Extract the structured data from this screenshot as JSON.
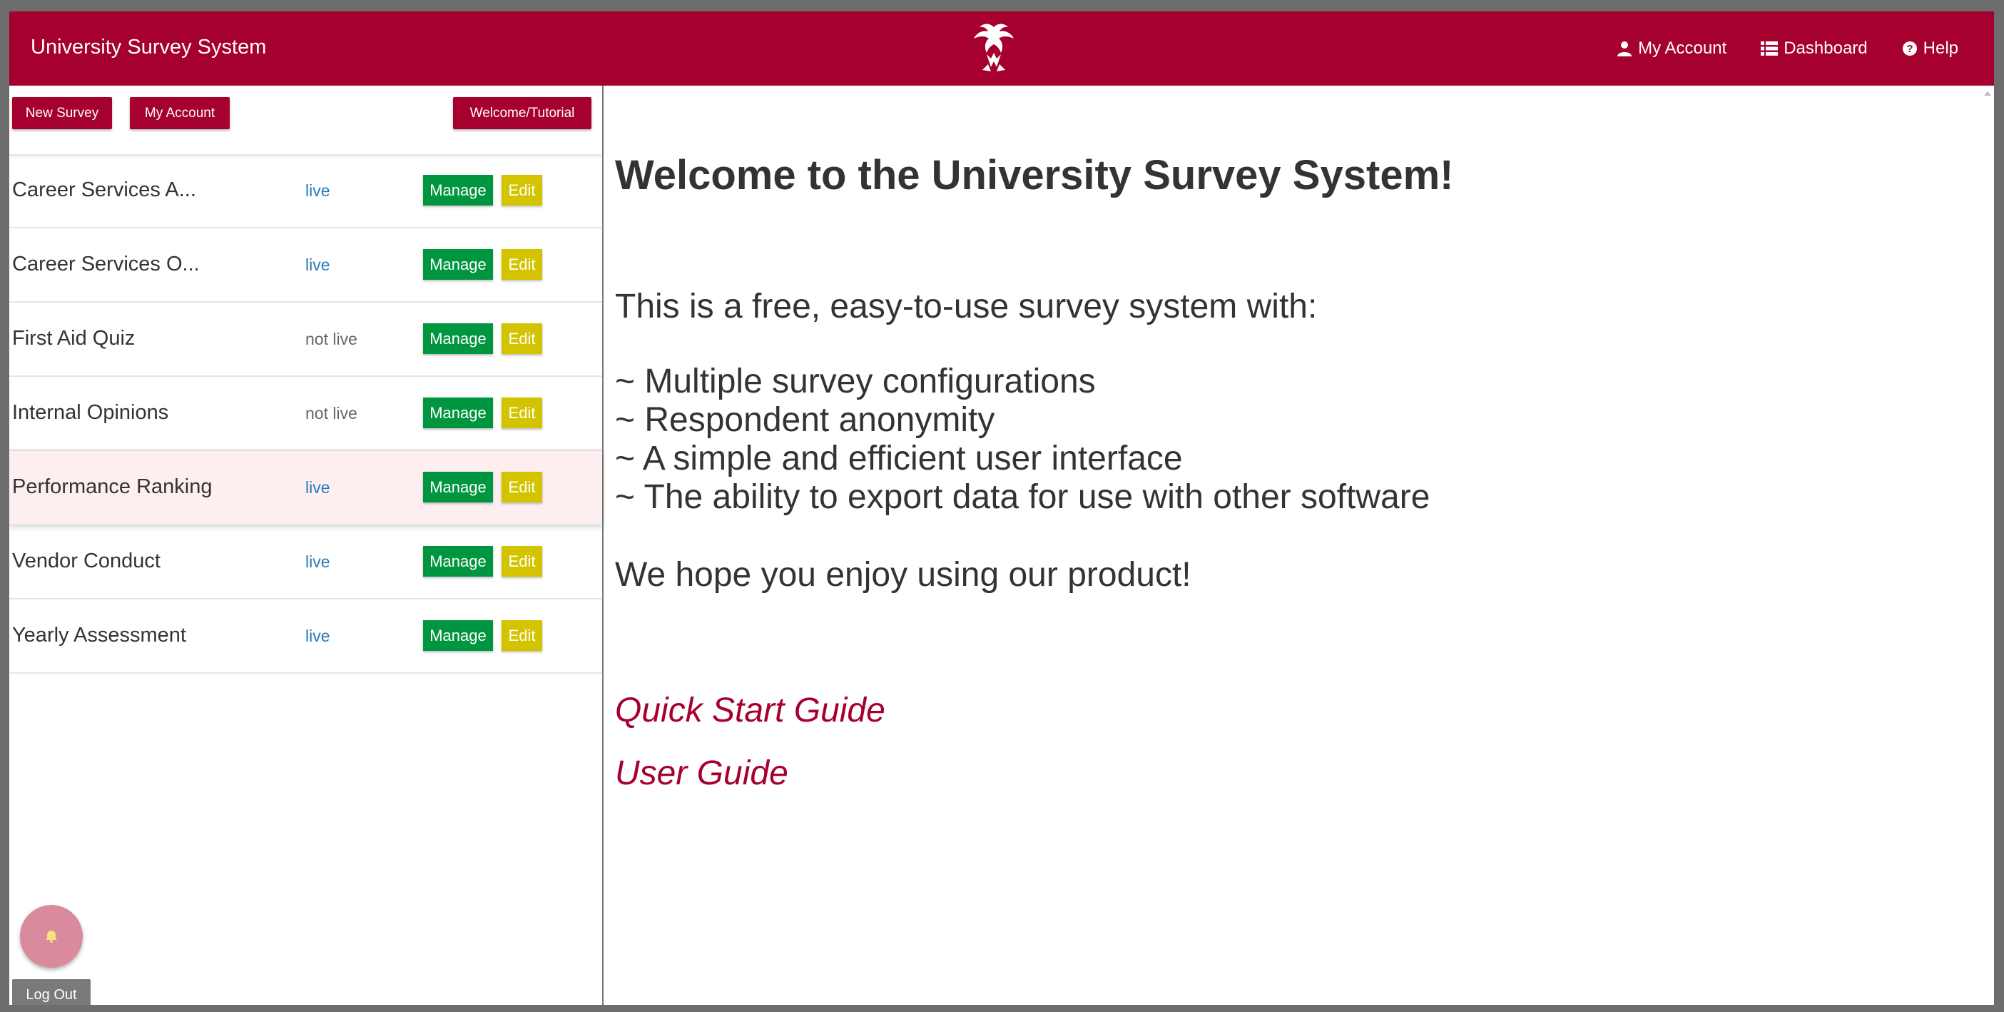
{
  "header": {
    "brand": "University Survey System",
    "nav": [
      {
        "label": "My Account",
        "icon": "user-icon"
      },
      {
        "label": "Dashboard",
        "icon": "list-icon"
      },
      {
        "label": "Help",
        "icon": "question-circle-icon"
      }
    ]
  },
  "sidebar": {
    "toolbar": {
      "new_survey": "New Survey",
      "my_account": "My Account",
      "welcome_tutorial": "Welcome/Tutorial"
    },
    "surveys": [
      {
        "name": "Career Services A...",
        "status": "live",
        "manage": "Manage",
        "edit": "Edit"
      },
      {
        "name": "Career Services O...",
        "status": "live",
        "manage": "Manage",
        "edit": "Edit"
      },
      {
        "name": "First Aid Quiz",
        "status": "not live",
        "manage": "Manage",
        "edit": "Edit"
      },
      {
        "name": "Internal Opinions",
        "status": "not live",
        "manage": "Manage",
        "edit": "Edit"
      },
      {
        "name": "Performance Ranking",
        "status": "live",
        "manage": "Manage",
        "edit": "Edit"
      },
      {
        "name": "Vendor Conduct",
        "status": "live",
        "manage": "Manage",
        "edit": "Edit"
      },
      {
        "name": "Yearly Assessment",
        "status": "live",
        "manage": "Manage",
        "edit": "Edit"
      }
    ],
    "logout": "Log Out"
  },
  "main": {
    "title": "Welcome to the University Survey System!",
    "intro": "This is a free, easy-to-use survey system with:",
    "features": [
      "~ Multiple survey configurations",
      "~ Respondent anonymity",
      "~ A simple and efficient user interface",
      "~ The ability to export data for use with other software"
    ],
    "closing": "We hope you enjoy using our product!",
    "links": {
      "quick_start": "Quick Start Guide",
      "user_guide": "User Guide"
    }
  },
  "colors": {
    "brand_red": "#a6002f",
    "manage_green": "#00953f",
    "edit_yellow": "#d4c400",
    "live_blue": "#2a7ab8"
  }
}
